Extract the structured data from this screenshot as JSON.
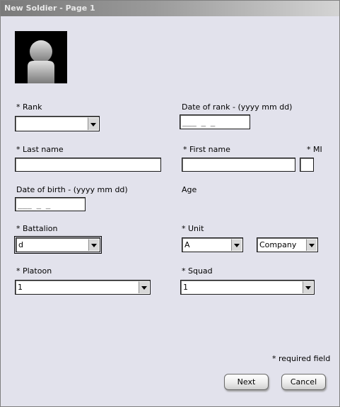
{
  "window": {
    "title": "New Soldier - Page 1"
  },
  "form": {
    "rank": {
      "label": "* Rank",
      "value": ""
    },
    "date_of_rank": {
      "label": "Date of rank - (yyyy mm dd)",
      "mask": "___ _ _"
    },
    "last_name": {
      "label": "* Last name",
      "value": ""
    },
    "first_name": {
      "label": "* First name",
      "value": ""
    },
    "mi": {
      "label": "* MI",
      "value": ""
    },
    "date_of_birth": {
      "label": "Date of birth - (yyyy mm dd)",
      "mask": "___ _ _"
    },
    "age": {
      "label": "Age"
    },
    "battalion": {
      "label": "* Battalion",
      "value": "d"
    },
    "unit": {
      "label": "* Unit",
      "value": "A",
      "company_value": "Company"
    },
    "platoon": {
      "label": "* Platoon",
      "value": "1"
    },
    "squad": {
      "label": "* Squad",
      "value": "1"
    }
  },
  "footer": {
    "required_note": "* required field",
    "next_label": "Next",
    "cancel_label": "Cancel"
  },
  "icons": {
    "avatar": "person-silhouette-icon",
    "dropdown": "chevron-down-icon"
  }
}
